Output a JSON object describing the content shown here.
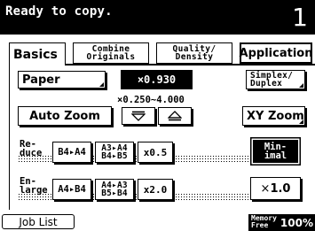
{
  "header": {
    "status": "Ready to copy.",
    "copies": "1"
  },
  "tabs": [
    {
      "label": "Basics"
    },
    {
      "line1": "Combine",
      "line2": "Originals"
    },
    {
      "line1": "Quality/",
      "line2": "Density"
    },
    {
      "label": "Application"
    }
  ],
  "paper": {
    "label": "Paper"
  },
  "zoom": {
    "value": "×0.930",
    "range": "×0.250∼4.000"
  },
  "simplex": {
    "line1": "Simplex/",
    "line2": "Duplex"
  },
  "auto_zoom": {
    "label": "Auto Zoom"
  },
  "xy_zoom": {
    "label": "XY Zoom"
  },
  "reduce": {
    "label1": "Re-",
    "label2": "duce",
    "b4_a4": "B4▸A4",
    "a3a4_b4b5": {
      "line1": "A3▸A4",
      "line2": "B4▸B5"
    },
    "x05": "x0.5"
  },
  "minimal": {
    "line1": "Min-",
    "line2": "imal"
  },
  "enlarge": {
    "label1": "En-",
    "label2": "large",
    "a4_b4": "A4▸B4",
    "a4a3_b5b4": {
      "line1": "A4▸A3",
      "line2": "B5▸B4"
    },
    "x20": "x2.0"
  },
  "fullsize": {
    "prefix": "×",
    "value": "1.0"
  },
  "footer": {
    "job_list": "Job List",
    "memory_line1": "Memory",
    "memory_line2": "Free",
    "memory_pct": "100%"
  }
}
